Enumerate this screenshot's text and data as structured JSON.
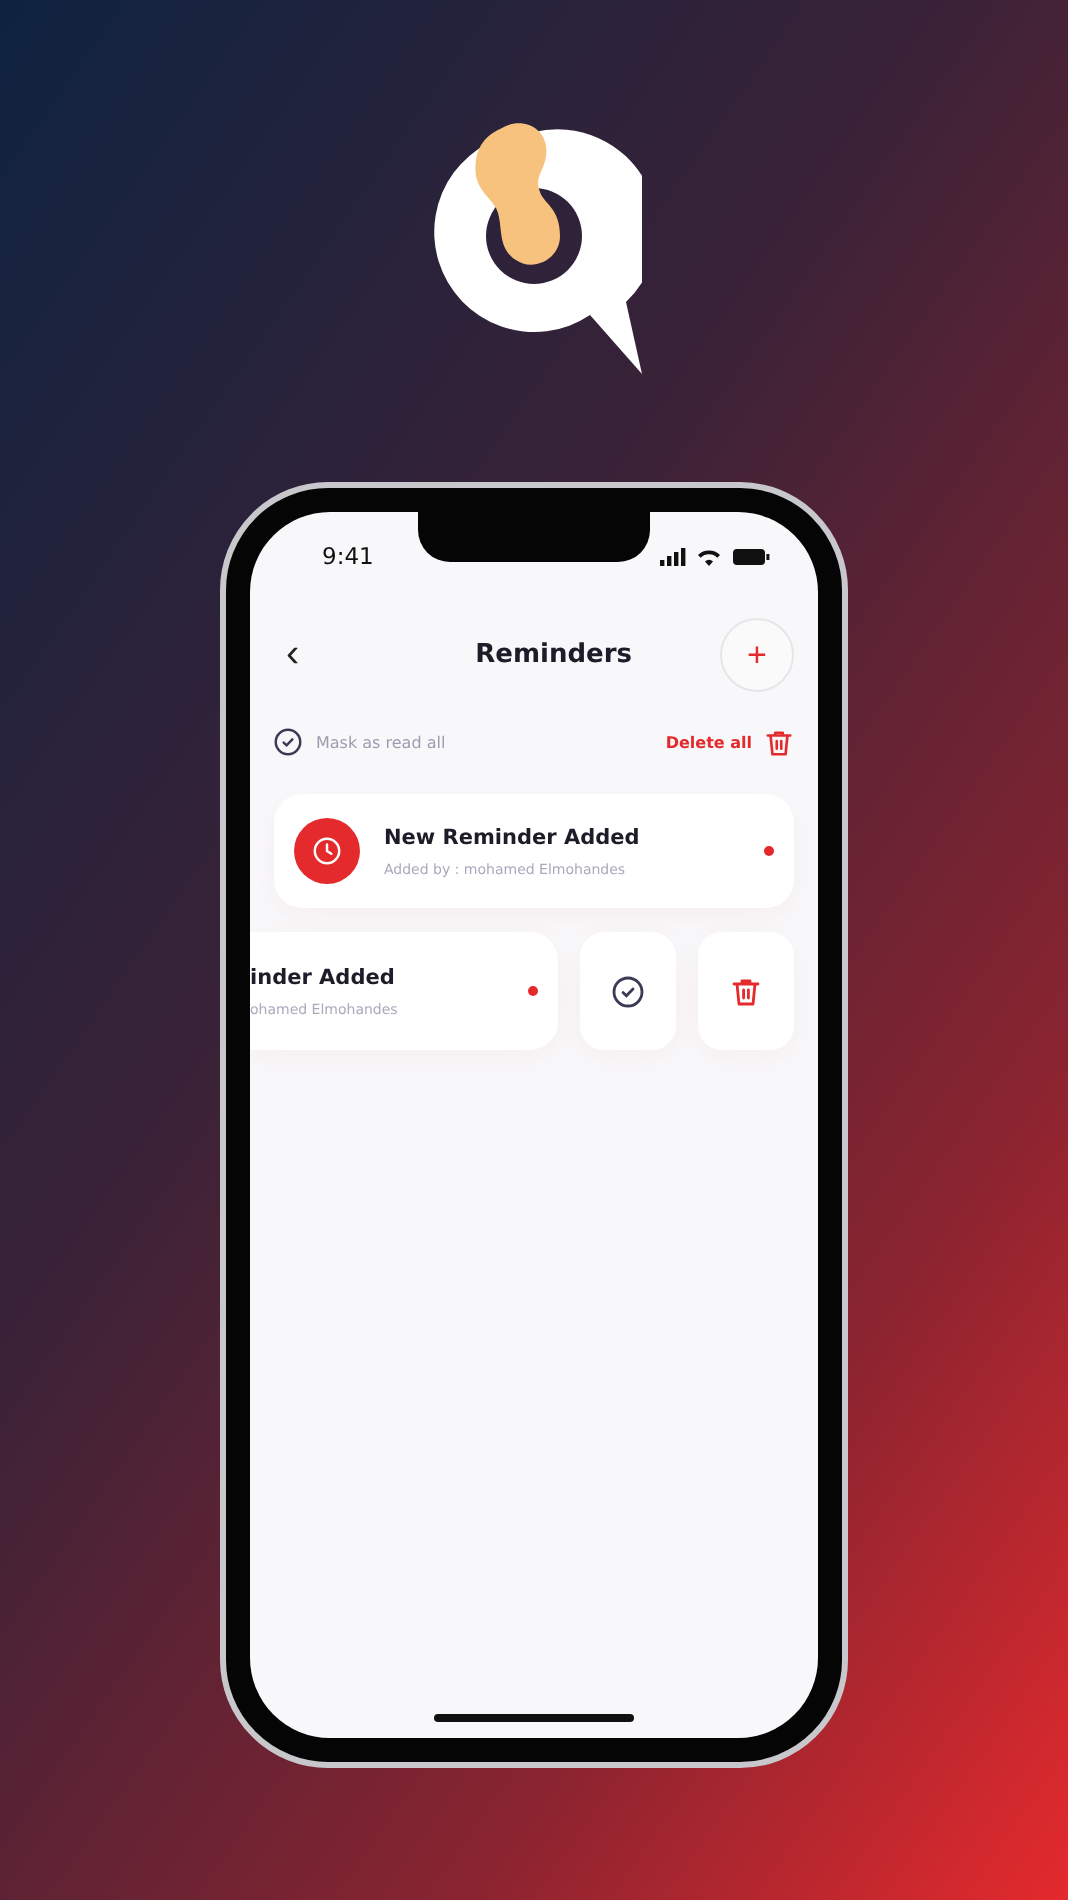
{
  "status_bar": {
    "time": "9:41"
  },
  "header": {
    "back": "‹",
    "title": "Reminders",
    "add": "+"
  },
  "toolbar": {
    "mark_all": "Mask as read all",
    "delete_all": "Delete all"
  },
  "reminders": [
    {
      "kind": "normal",
      "title": "New Reminder Added",
      "subtitle": "Added by : mohamed Elmohandes",
      "unread": true
    },
    {
      "kind": "swiped",
      "title": "inder Added",
      "subtitle": "ohamed Elmohandes",
      "unread": true
    }
  ]
}
